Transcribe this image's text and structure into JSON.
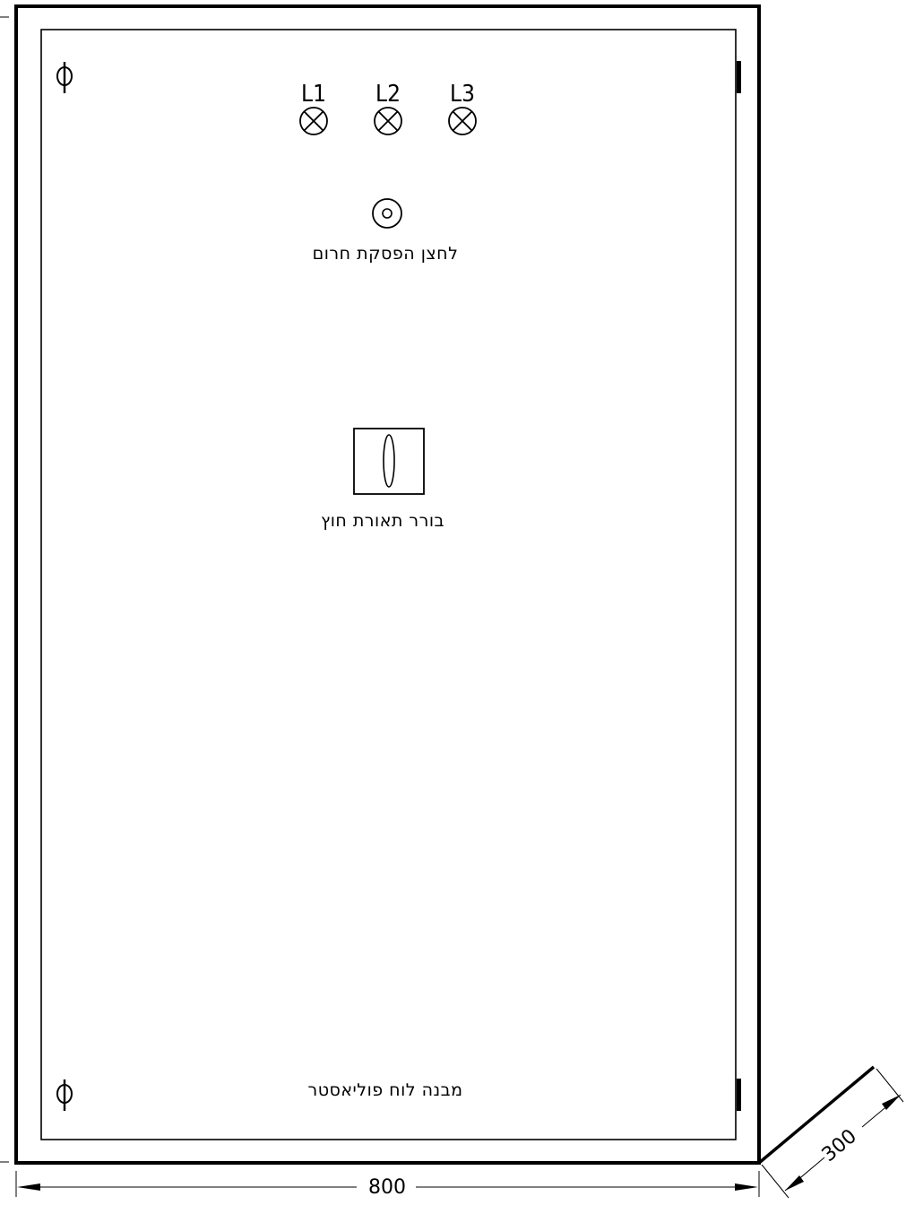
{
  "panel": {
    "title": "מבנה לוח פוליאסטר"
  },
  "lamps": [
    {
      "label": "L1"
    },
    {
      "label": "L2"
    },
    {
      "label": "L3"
    }
  ],
  "emergency_button": {
    "label": "לחצן הפסקת חרום"
  },
  "selector_switch": {
    "label": "בורר תאורת חוץ"
  },
  "dimensions": {
    "width": "800",
    "depth": "300"
  },
  "icons": {
    "lamp": "lamp-cross-circle-icon",
    "button": "push-button-icon",
    "switch": "rotary-selector-icon",
    "lock": "lock-phi-icon",
    "hinge": "hinge-icon"
  }
}
